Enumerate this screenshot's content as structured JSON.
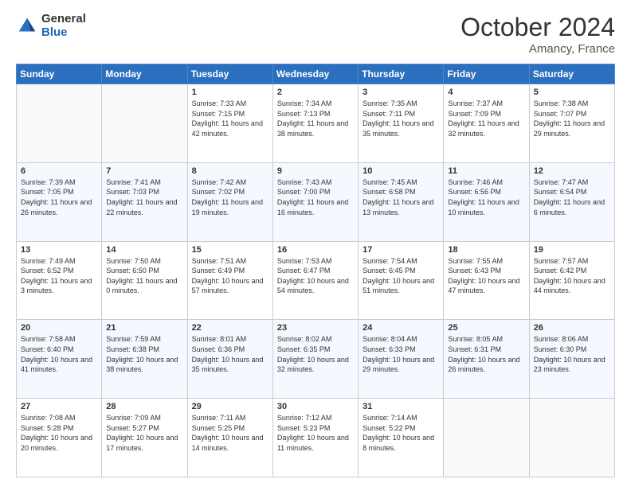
{
  "logo": {
    "general": "General",
    "blue": "Blue"
  },
  "title": {
    "month": "October 2024",
    "location": "Amancy, France"
  },
  "days_of_week": [
    "Sunday",
    "Monday",
    "Tuesday",
    "Wednesday",
    "Thursday",
    "Friday",
    "Saturday"
  ],
  "weeks": [
    [
      {
        "day": "",
        "empty": true
      },
      {
        "day": "",
        "empty": true
      },
      {
        "day": "1",
        "sunrise": "Sunrise: 7:33 AM",
        "sunset": "Sunset: 7:15 PM",
        "daylight": "Daylight: 11 hours and 42 minutes."
      },
      {
        "day": "2",
        "sunrise": "Sunrise: 7:34 AM",
        "sunset": "Sunset: 7:13 PM",
        "daylight": "Daylight: 11 hours and 38 minutes."
      },
      {
        "day": "3",
        "sunrise": "Sunrise: 7:35 AM",
        "sunset": "Sunset: 7:11 PM",
        "daylight": "Daylight: 11 hours and 35 minutes."
      },
      {
        "day": "4",
        "sunrise": "Sunrise: 7:37 AM",
        "sunset": "Sunset: 7:09 PM",
        "daylight": "Daylight: 11 hours and 32 minutes."
      },
      {
        "day": "5",
        "sunrise": "Sunrise: 7:38 AM",
        "sunset": "Sunset: 7:07 PM",
        "daylight": "Daylight: 11 hours and 29 minutes."
      }
    ],
    [
      {
        "day": "6",
        "sunrise": "Sunrise: 7:39 AM",
        "sunset": "Sunset: 7:05 PM",
        "daylight": "Daylight: 11 hours and 26 minutes."
      },
      {
        "day": "7",
        "sunrise": "Sunrise: 7:41 AM",
        "sunset": "Sunset: 7:03 PM",
        "daylight": "Daylight: 11 hours and 22 minutes."
      },
      {
        "day": "8",
        "sunrise": "Sunrise: 7:42 AM",
        "sunset": "Sunset: 7:02 PM",
        "daylight": "Daylight: 11 hours and 19 minutes."
      },
      {
        "day": "9",
        "sunrise": "Sunrise: 7:43 AM",
        "sunset": "Sunset: 7:00 PM",
        "daylight": "Daylight: 11 hours and 16 minutes."
      },
      {
        "day": "10",
        "sunrise": "Sunrise: 7:45 AM",
        "sunset": "Sunset: 6:58 PM",
        "daylight": "Daylight: 11 hours and 13 minutes."
      },
      {
        "day": "11",
        "sunrise": "Sunrise: 7:46 AM",
        "sunset": "Sunset: 6:56 PM",
        "daylight": "Daylight: 11 hours and 10 minutes."
      },
      {
        "day": "12",
        "sunrise": "Sunrise: 7:47 AM",
        "sunset": "Sunset: 6:54 PM",
        "daylight": "Daylight: 11 hours and 6 minutes."
      }
    ],
    [
      {
        "day": "13",
        "sunrise": "Sunrise: 7:49 AM",
        "sunset": "Sunset: 6:52 PM",
        "daylight": "Daylight: 11 hours and 3 minutes."
      },
      {
        "day": "14",
        "sunrise": "Sunrise: 7:50 AM",
        "sunset": "Sunset: 6:50 PM",
        "daylight": "Daylight: 11 hours and 0 minutes."
      },
      {
        "day": "15",
        "sunrise": "Sunrise: 7:51 AM",
        "sunset": "Sunset: 6:49 PM",
        "daylight": "Daylight: 10 hours and 57 minutes."
      },
      {
        "day": "16",
        "sunrise": "Sunrise: 7:53 AM",
        "sunset": "Sunset: 6:47 PM",
        "daylight": "Daylight: 10 hours and 54 minutes."
      },
      {
        "day": "17",
        "sunrise": "Sunrise: 7:54 AM",
        "sunset": "Sunset: 6:45 PM",
        "daylight": "Daylight: 10 hours and 51 minutes."
      },
      {
        "day": "18",
        "sunrise": "Sunrise: 7:55 AM",
        "sunset": "Sunset: 6:43 PM",
        "daylight": "Daylight: 10 hours and 47 minutes."
      },
      {
        "day": "19",
        "sunrise": "Sunrise: 7:57 AM",
        "sunset": "Sunset: 6:42 PM",
        "daylight": "Daylight: 10 hours and 44 minutes."
      }
    ],
    [
      {
        "day": "20",
        "sunrise": "Sunrise: 7:58 AM",
        "sunset": "Sunset: 6:40 PM",
        "daylight": "Daylight: 10 hours and 41 minutes."
      },
      {
        "day": "21",
        "sunrise": "Sunrise: 7:59 AM",
        "sunset": "Sunset: 6:38 PM",
        "daylight": "Daylight: 10 hours and 38 minutes."
      },
      {
        "day": "22",
        "sunrise": "Sunrise: 8:01 AM",
        "sunset": "Sunset: 6:36 PM",
        "daylight": "Daylight: 10 hours and 35 minutes."
      },
      {
        "day": "23",
        "sunrise": "Sunrise: 8:02 AM",
        "sunset": "Sunset: 6:35 PM",
        "daylight": "Daylight: 10 hours and 32 minutes."
      },
      {
        "day": "24",
        "sunrise": "Sunrise: 8:04 AM",
        "sunset": "Sunset: 6:33 PM",
        "daylight": "Daylight: 10 hours and 29 minutes."
      },
      {
        "day": "25",
        "sunrise": "Sunrise: 8:05 AM",
        "sunset": "Sunset: 6:31 PM",
        "daylight": "Daylight: 10 hours and 26 minutes."
      },
      {
        "day": "26",
        "sunrise": "Sunrise: 8:06 AM",
        "sunset": "Sunset: 6:30 PM",
        "daylight": "Daylight: 10 hours and 23 minutes."
      }
    ],
    [
      {
        "day": "27",
        "sunrise": "Sunrise: 7:08 AM",
        "sunset": "Sunset: 5:28 PM",
        "daylight": "Daylight: 10 hours and 20 minutes."
      },
      {
        "day": "28",
        "sunrise": "Sunrise: 7:09 AM",
        "sunset": "Sunset: 5:27 PM",
        "daylight": "Daylight: 10 hours and 17 minutes."
      },
      {
        "day": "29",
        "sunrise": "Sunrise: 7:11 AM",
        "sunset": "Sunset: 5:25 PM",
        "daylight": "Daylight: 10 hours and 14 minutes."
      },
      {
        "day": "30",
        "sunrise": "Sunrise: 7:12 AM",
        "sunset": "Sunset: 5:23 PM",
        "daylight": "Daylight: 10 hours and 11 minutes."
      },
      {
        "day": "31",
        "sunrise": "Sunrise: 7:14 AM",
        "sunset": "Sunset: 5:22 PM",
        "daylight": "Daylight: 10 hours and 8 minutes."
      },
      {
        "day": "",
        "empty": true
      },
      {
        "day": "",
        "empty": true
      }
    ]
  ]
}
